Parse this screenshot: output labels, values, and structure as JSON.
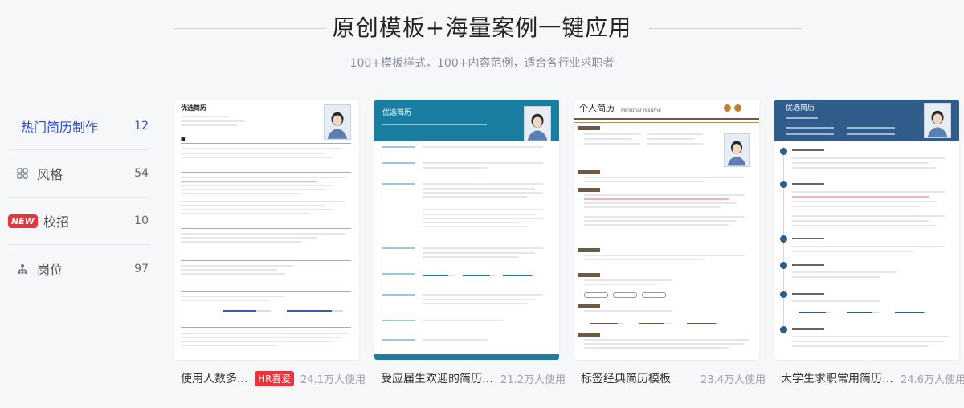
{
  "header": {
    "title": "原创模板+海量案例一键应用",
    "subtitle": "100+模板样式，100+内容范例，适合各行业求职者"
  },
  "sidebar": {
    "items": [
      {
        "label": "热门简历制作",
        "count": "12",
        "icon": ""
      },
      {
        "label": "风格",
        "count": "54",
        "icon": "grid-icon"
      },
      {
        "label": "校招",
        "count": "10",
        "icon": "new-badge",
        "badge": "NEW"
      },
      {
        "label": "岗位",
        "count": "97",
        "icon": "org-chart-icon"
      }
    ]
  },
  "cards": [
    {
      "name": "使用人数多…",
      "badge": "HR喜爱",
      "uses": "24.1万人使用",
      "resume_title": "优选简历"
    },
    {
      "name": "受应届生欢迎的简历…",
      "uses": "21.2万人使用",
      "resume_title": "优选简历"
    },
    {
      "name": "标签经典简历模板",
      "uses": "23.4万人使用",
      "resume_title": "个人简历",
      "resume_subtitle": "Personal resume"
    },
    {
      "name": "大学生求职常用简历…",
      "uses": "24.6万人使用",
      "resume_title": "优选简历"
    }
  ],
  "colors": {
    "accent": "#2b4bd6",
    "badge_red": "#e8333b",
    "teal": "#1a7ea0",
    "brown": "#6b5a48",
    "navy": "#2f5c8a"
  }
}
